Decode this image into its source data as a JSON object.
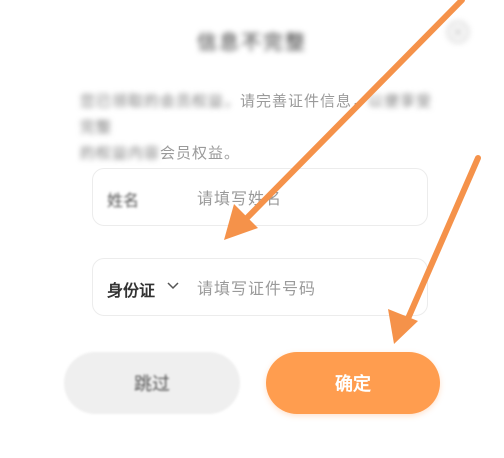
{
  "dialog": {
    "title": "信息不完整",
    "description_prefix": "您已领取的会员权益，",
    "description_visible": "请完善证件信息，",
    "description_suffix": "以便享受完整",
    "description_line2_blurred": "的权益内容",
    "description_line2_visible": "会员权益。"
  },
  "form": {
    "name_label": "姓名",
    "name_placeholder": "请填写姓名",
    "id_type_label": "身份证",
    "id_placeholder": "请填写证件号码"
  },
  "buttons": {
    "skip_label": "跳过",
    "confirm_label": "确定"
  },
  "annotation": {
    "arrow_color": "#f5924a"
  },
  "colors": {
    "accent": "#ff9d4f",
    "skip_bg": "#efefef"
  }
}
